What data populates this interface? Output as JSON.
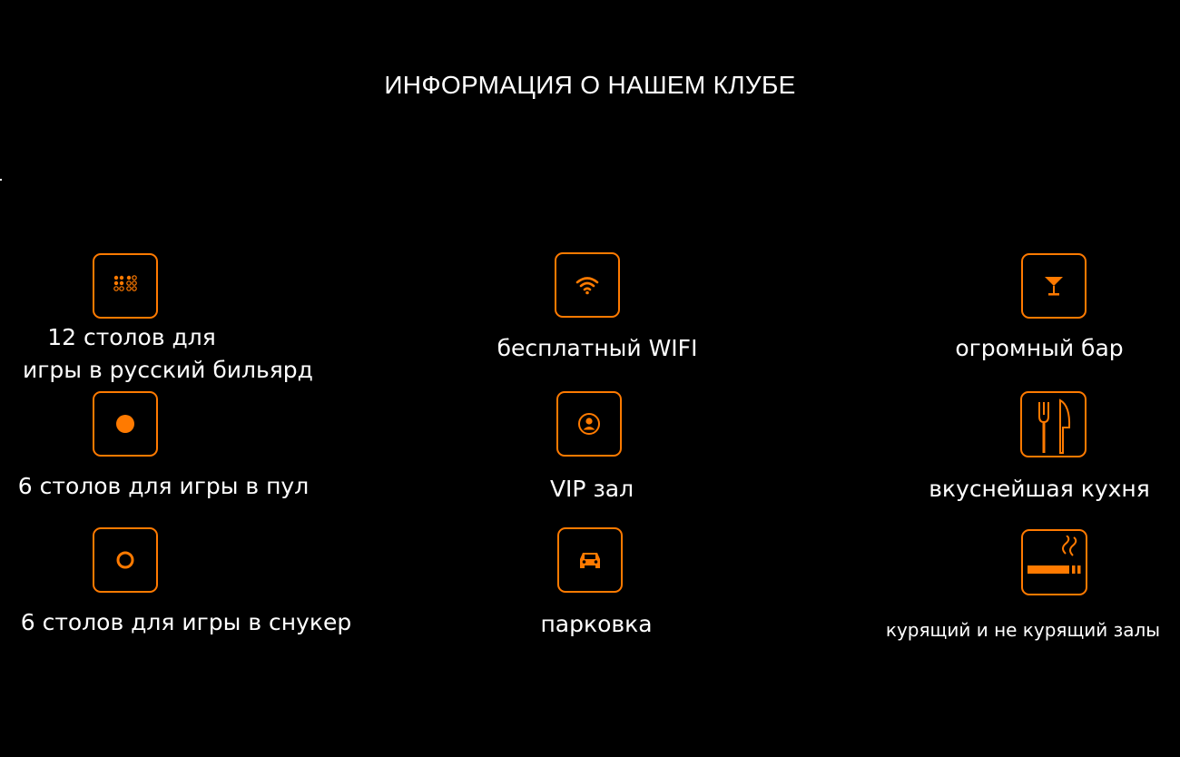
{
  "page": {
    "title": "ИНФОРМАЦИЯ О НАШЕМ КЛУБЕ"
  },
  "accent_color": "#ff7a00",
  "features": [
    {
      "icon": "billiard-balls-icon",
      "line1": "12 столов для",
      "line2": "игры в русский бильярд"
    },
    {
      "icon": "wifi-icon",
      "label": "бесплатный WIFI"
    },
    {
      "icon": "cocktail-glass-icon",
      "label": "огромный бар"
    },
    {
      "icon": "solid-ball-icon",
      "label": "6 столов для игры в пул"
    },
    {
      "icon": "vip-user-icon",
      "label": "VIP зал"
    },
    {
      "icon": "fork-knife-icon",
      "label": "вкуснейшая кухня"
    },
    {
      "icon": "ring-ball-icon",
      "label": "6 столов для игры в снукер"
    },
    {
      "icon": "car-icon",
      "label": "парковка"
    },
    {
      "icon": "cigarette-icon",
      "label": "курящий и не курящий залы"
    }
  ]
}
